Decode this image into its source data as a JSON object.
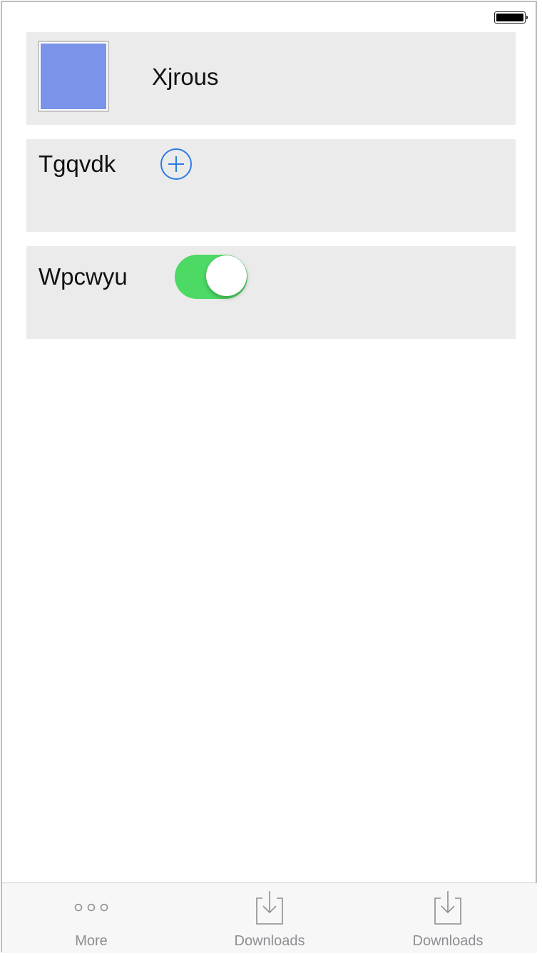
{
  "status_bar": {
    "battery_icon": "battery-full-icon"
  },
  "rows": [
    {
      "title": "Xjrous",
      "swatch_color": "#7b93e8"
    },
    {
      "title": "Tgqvdk",
      "action_icon": "plus-circle-icon",
      "accent_color": "#2c7be5"
    },
    {
      "title": "Wpcwyu",
      "toggle_on": true,
      "toggle_color": "#4cd964"
    }
  ],
  "tabbar": {
    "tabs": [
      {
        "label": "More",
        "icon": "more-icon"
      },
      {
        "label": "Downloads",
        "icon": "download-icon"
      },
      {
        "label": "Downloads",
        "icon": "download-icon"
      }
    ]
  }
}
